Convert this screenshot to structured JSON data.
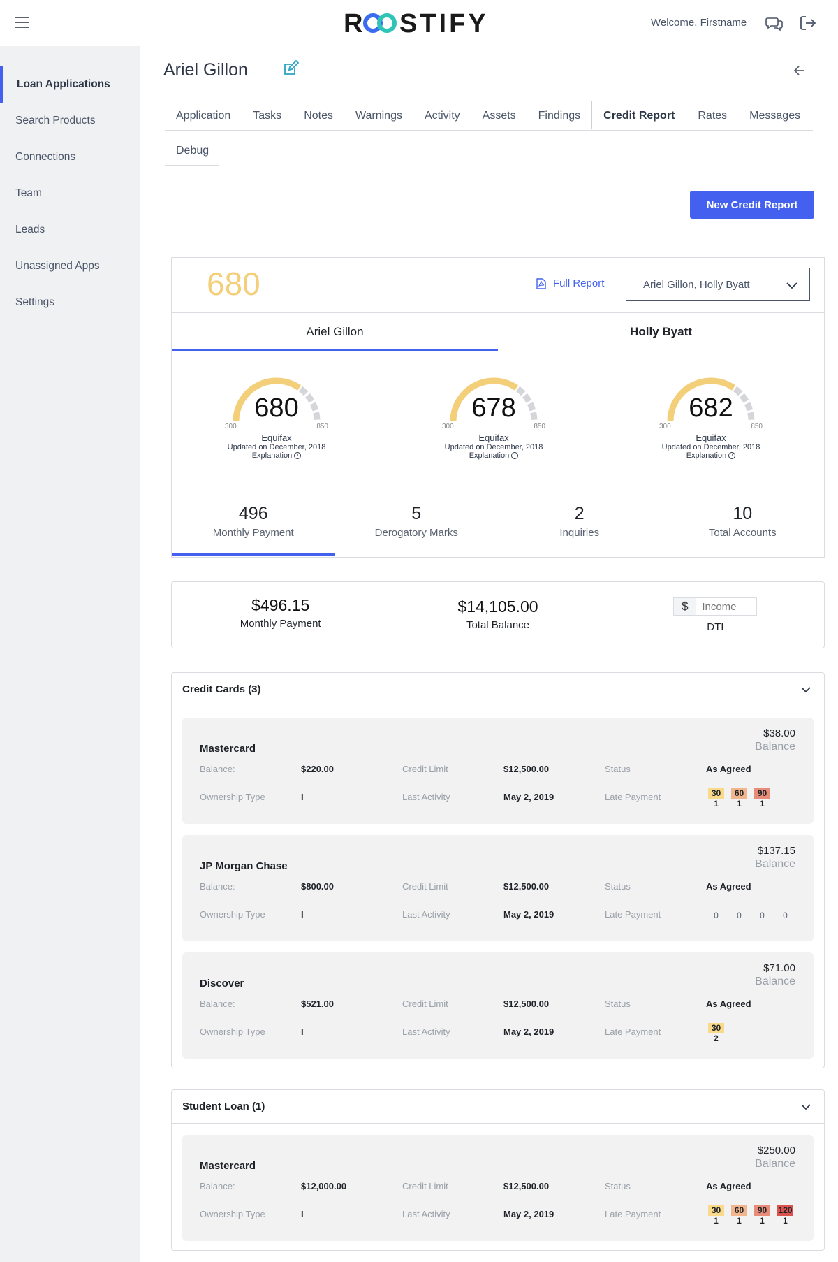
{
  "header": {
    "logo_text": "ROOSTIFY",
    "welcome": "Welcome, Firstname",
    "icons": [
      "menu-icon",
      "chat-icon",
      "logout-icon"
    ],
    "brand_colors": {
      "primary": "#4361ee",
      "logo_loop_blue": "#3b6cf0",
      "logo_loop_teal": "#2ec4b6",
      "gauge_gold": "#f3cf7a"
    }
  },
  "sidebar": {
    "items": [
      {
        "label": "Loan Applications",
        "active": true
      },
      {
        "label": "Search Products"
      },
      {
        "label": "Connections"
      },
      {
        "label": "Team"
      },
      {
        "label": "Leads"
      },
      {
        "label": "Unassigned Apps"
      },
      {
        "label": "Settings"
      }
    ]
  },
  "page": {
    "title": "Ariel Gillon",
    "tabs": [
      "Application",
      "Tasks",
      "Notes",
      "Warnings",
      "Activity",
      "Assets",
      "Findings",
      "Credit Report",
      "Rates",
      "Messages"
    ],
    "active_tab": "Credit Report",
    "tabs_row2": [
      "Debug"
    ],
    "new_report_button": "New Credit Report"
  },
  "score_card": {
    "score": "680",
    "full_report_link": "Full Report",
    "borrower_select": "Ariel Gillon, Holly Byatt",
    "person_tabs": [
      "Ariel Gillon",
      "Holly Byatt"
    ],
    "gauges": [
      {
        "score": "680",
        "min": "300",
        "max": "850",
        "bureau": "Equifax",
        "updated": "Updated on December, 2018",
        "explanation": "Explanation",
        "fill": 0.69
      },
      {
        "score": "678",
        "min": "300",
        "max": "850",
        "bureau": "Equifax",
        "updated": "Updated on December, 2018",
        "explanation": "Explanation",
        "fill": 0.69
      },
      {
        "score": "682",
        "min": "300",
        "max": "850",
        "bureau": "Equifax",
        "updated": "Updated on December, 2018",
        "explanation": "Explanation",
        "fill": 0.69
      }
    ],
    "stats": [
      {
        "value": "496",
        "label": "Monthly Payment"
      },
      {
        "value": "5",
        "label": "Derogatory Marks"
      },
      {
        "value": "2",
        "label": "Inquiries"
      },
      {
        "value": "10",
        "label": "Total Accounts"
      }
    ]
  },
  "summary": {
    "monthly_payment": {
      "value": "$496.15",
      "label": "Monthly Payment"
    },
    "total_balance": {
      "value": "$14,105.00",
      "label": "Total Balance"
    },
    "dti": {
      "currency": "$",
      "placeholder": "Income",
      "label": "DTI"
    }
  },
  "labels": {
    "balance": "Balance:",
    "credit_limit": "Credit Limit",
    "status": "Status",
    "ownership": "Ownership Type",
    "last_activity": "Last Activity",
    "late_payment": "Late Payment",
    "balance_caption": "Balance"
  },
  "late_colors": {
    "30": "#f9d98a",
    "60": "#f2b58c",
    "90": "#e88c7a",
    "120": "#d9534f"
  },
  "credit_cards": {
    "title": "Credit Cards  (3)",
    "accounts": [
      {
        "name": "Mastercard",
        "top_balance": "$38.00",
        "balance": "$220.00",
        "credit_limit": "$12,500.00",
        "status": "As Agreed",
        "ownership": "I",
        "last_activity": "May 2, 2019",
        "late": [
          {
            "days": "30",
            "count": "1"
          },
          {
            "days": "60",
            "count": "1"
          },
          {
            "days": "90",
            "count": "1"
          }
        ]
      },
      {
        "name": "JP Morgan Chase",
        "top_balance": "$137.15",
        "balance": "$800.00",
        "credit_limit": "$12,500.00",
        "status": "As Agreed",
        "ownership": "I",
        "last_activity": "May 2, 2019",
        "late_zero": [
          "0",
          "0",
          "0",
          "0"
        ]
      },
      {
        "name": "Discover",
        "top_balance": "$71.00",
        "balance": "$521.00",
        "credit_limit": "$12,500.00",
        "status": "As Agreed",
        "ownership": "I",
        "last_activity": "May 2, 2019",
        "late": [
          {
            "days": "30",
            "count": "2"
          }
        ]
      }
    ]
  },
  "student_loans": {
    "title": "Student Loan (1)",
    "accounts": [
      {
        "name": "Mastercard",
        "top_balance": "$250.00",
        "balance": "$12,000.00",
        "credit_limit": "$12,500.00",
        "status": "As Agreed",
        "ownership": "I",
        "last_activity": "May 2, 2019",
        "late": [
          {
            "days": "30",
            "count": "1"
          },
          {
            "days": "60",
            "count": "1"
          },
          {
            "days": "90",
            "count": "1"
          },
          {
            "days": "120",
            "count": "1"
          }
        ]
      }
    ]
  }
}
